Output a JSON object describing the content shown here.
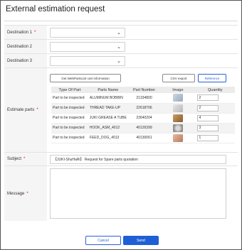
{
  "page": {
    "title": "External estimation request"
  },
  "form": {
    "destination1": {
      "label": "Destination 1",
      "required": "*",
      "value": ""
    },
    "destination2": {
      "label": "Destination 2",
      "value": ""
    },
    "destination3": {
      "label": "Destination 3",
      "value": ""
    },
    "estimate": {
      "label": "Estimate parts",
      "required": "*",
      "get_cart_button": "Get WebPartsList cart information",
      "csv_button": "CSV export",
      "reference_button": "Reference",
      "columns": [
        "Type Of Part",
        "Parts Name",
        "Part Number",
        "Image",
        "Quantity"
      ],
      "rows": [
        {
          "type": "Part to be inspected",
          "name": "ALUMINUM BOBBIN",
          "number": "21334800",
          "image": "bobbin-thumbnail",
          "quantity": "2"
        },
        {
          "type": "Part to be inspected",
          "name": "THREAD TAKE-UP",
          "number": "22618706",
          "image": "thread-takeup-thumbnail",
          "quantity": "2"
        },
        {
          "type": "Part to be inspected",
          "name": "JUKI GREASE A TUBE",
          "number": "23640204",
          "image": "grease-tube-thumbnail",
          "quantity": "4"
        },
        {
          "type": "Part to be inspected",
          "name": "HOOK_ASM_4012",
          "number": "40126399",
          "image": "hook-assembly-thumbnail",
          "quantity": "3"
        },
        {
          "type": "Part to be inspected",
          "name": "FEED_DOG_4013",
          "number": "40130061",
          "image": "feed-dog-thumbnail",
          "quantity": "1"
        }
      ]
    },
    "subject": {
      "label": "Subject",
      "required": "*",
      "value": "【JUKI-ShuHaRi】 Request for Spare parts quotation"
    },
    "message": {
      "label": "Message",
      "required": "*",
      "value": ""
    }
  },
  "footer": {
    "cancel": "Cancel",
    "send": "Send"
  },
  "colors": {
    "accent": "#1f5fd6",
    "required": "#d0021b"
  }
}
